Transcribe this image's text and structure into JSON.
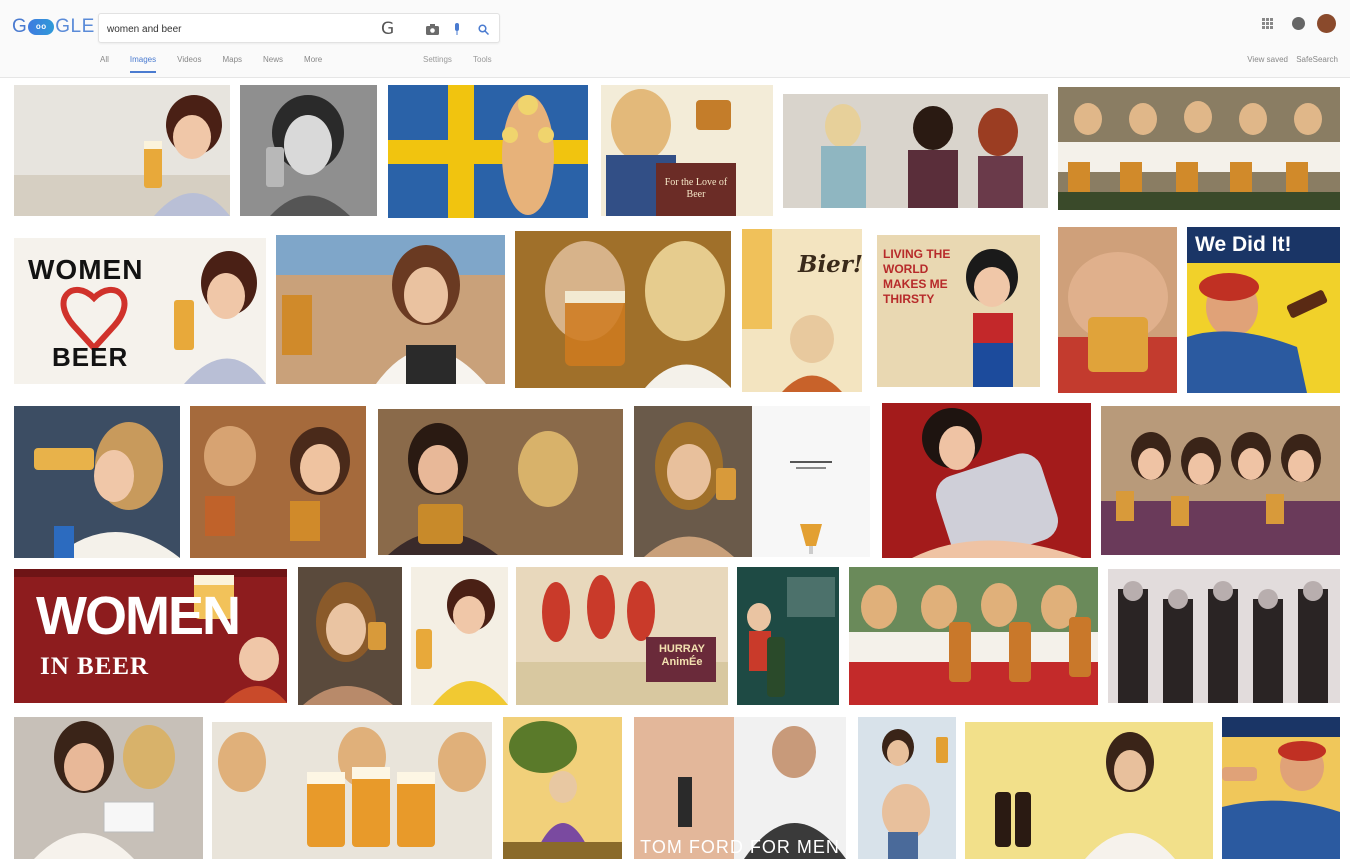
{
  "header": {
    "logo_text_1": "G",
    "logo_doodle": "oo",
    "logo_text_2": "GLE",
    "search_value": "women and beer",
    "tabs": [
      {
        "label": "All",
        "active": false
      },
      {
        "label": "Images",
        "active": true
      },
      {
        "label": "Videos",
        "active": false
      },
      {
        "label": "Maps",
        "active": false
      },
      {
        "label": "News",
        "active": false
      },
      {
        "label": "More",
        "active": false
      }
    ],
    "settings_label": "Settings",
    "tools_label": "Tools",
    "view_saved_label": "View saved",
    "safesearch_label": "SafeSearch",
    "avatar_initial": "",
    "icons": {
      "search": "search-icon",
      "camera": "camera-icon",
      "mic": "microphone-icon",
      "apps": "apps-grid-icon",
      "notifications": "notifications-icon"
    }
  },
  "tiles": {
    "t2_text": "For the Love of Beer",
    "t6_line1": "WOMEN",
    "t6_line2": "BEER",
    "t9_text": "Bier!",
    "t10_text": "LIVING THE WORLD MAKES ME THIRSTY",
    "t11_text": "We Did It!",
    "t19_line1": "WOMEN",
    "t19_line2": "IN BEER",
    "t22_text": "HURRAY AnimÉe",
    "t28_text": "TOM FORD FOR MEN"
  },
  "colors": {
    "accent": "#4a7bd0",
    "header_bg": "#fafafa"
  }
}
